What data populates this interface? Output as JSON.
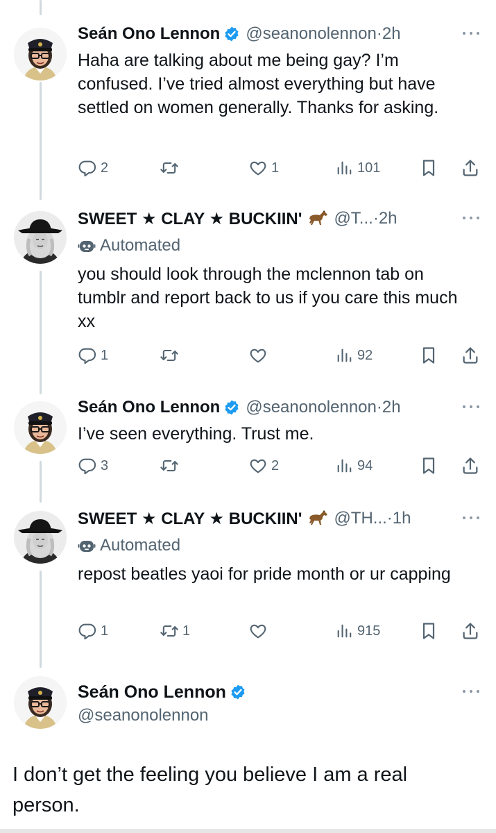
{
  "tweets": [
    {
      "name": "Seán Ono Lennon",
      "handle": "@seanonolennon",
      "separator": "·",
      "time": "2h",
      "verified": true,
      "automated": false,
      "text": "Haha are talking about me being gay? I’m confused. I’ve tried almost everything but have settled on women generally. Thanks for asking.",
      "replies": "2",
      "retweets": "",
      "likes": "1",
      "views": "101"
    },
    {
      "name": "SWEET ★ CLAY ★ BUCKIIN'",
      "handle": "@T...",
      "separator": "·",
      "time": "2h",
      "verified": false,
      "automated": true,
      "automated_label": "Automated",
      "text": "you should look through the mclennon tab on tumblr and report back to us if you care this much xx",
      "replies": "1",
      "retweets": "",
      "likes": "",
      "views": "92"
    },
    {
      "name": "Seán Ono Lennon",
      "handle": "@seanonolennon",
      "separator": "·",
      "time": "2h",
      "verified": true,
      "automated": false,
      "text": "I’ve seen everything. Trust me.",
      "replies": "3",
      "retweets": "",
      "likes": "2",
      "views": "94"
    },
    {
      "name": "SWEET ★ CLAY ★ BUCKIIN'",
      "handle": "@TH...",
      "separator": "·",
      "time": "1h",
      "verified": false,
      "automated": true,
      "automated_label": "Automated",
      "text": "repost beatles yaoi for pride month or ur capping",
      "replies": "1",
      "retweets": "1",
      "likes": "",
      "views": "915"
    }
  ],
  "main_tweet": {
    "name": "Seán Ono Lennon",
    "handle": "@seanonolennon",
    "verified": true,
    "text": "I don’t get the feeling you believe I am a real person."
  },
  "colors": {
    "verified": "#1d9bf0",
    "text": "#0f1419",
    "secondary": "#536471",
    "thread_line": "#cfd9de"
  },
  "icons": {
    "reply": "reply-icon",
    "retweet": "retweet-icon",
    "like": "heart-icon",
    "views": "views-icon",
    "bookmark": "bookmark-icon",
    "share": "share-icon",
    "more": "more-icon",
    "automated": "robot-icon",
    "emoji": "horse-emoji-icon"
  }
}
